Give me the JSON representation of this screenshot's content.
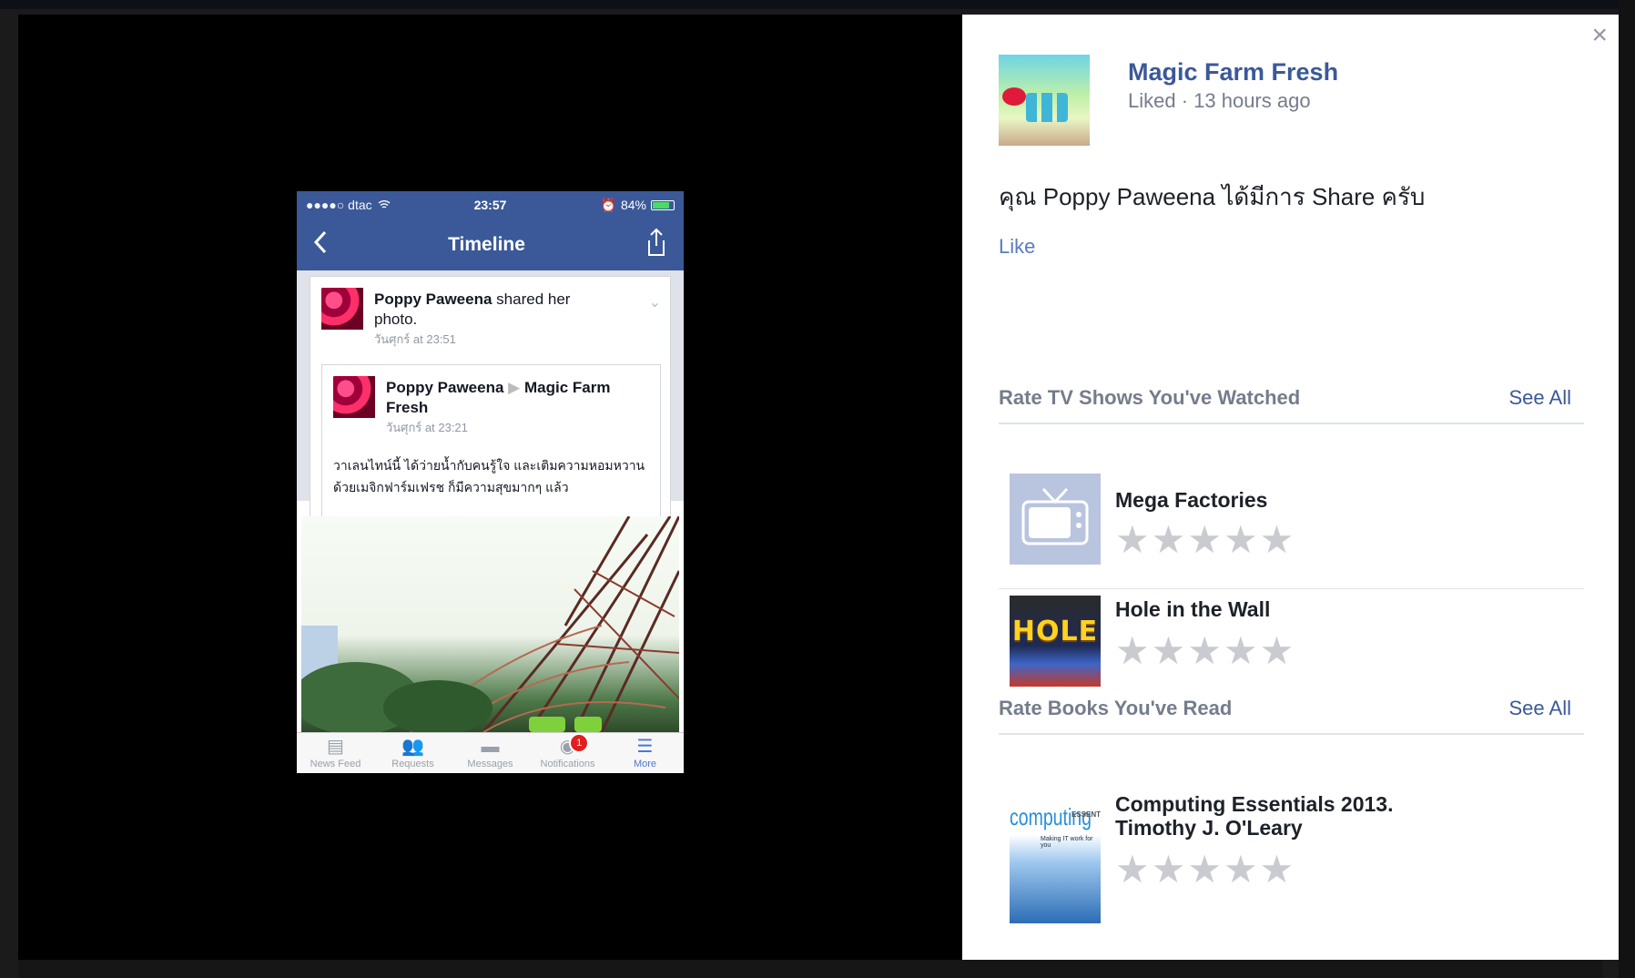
{
  "phone": {
    "status": {
      "carrier": "●●●●○ dtac",
      "time": "23:57",
      "battery": "84%"
    },
    "nav_title": "Timeline",
    "post": {
      "author": "Poppy Paweena",
      "action": "shared her photo.",
      "time": "วันศุกร์ at 23:51",
      "inner_author": "Poppy Paweena",
      "inner_arrow": "▶",
      "inner_target": "Magic Farm Fresh",
      "inner_time": "วันศุกร์ at 23:21",
      "text": "วาเลนไทน์นี้ ได้ว่ายน้ำกับคนรู้ใจ และเติมความหอมหวานด้วยเมจิกฟาร์มเฟรช ก็มีความสุขมากๆ แล้ว"
    },
    "tabs": [
      {
        "label": "News Feed",
        "icon": "news-feed-icon",
        "glyph": "▤"
      },
      {
        "label": "Requests",
        "icon": "friend-requests-icon",
        "glyph": "👥"
      },
      {
        "label": "Messages",
        "icon": "messages-icon",
        "glyph": "▬"
      },
      {
        "label": "Notifications",
        "icon": "globe-icon",
        "glyph": "◉",
        "badge": "1"
      },
      {
        "label": "More",
        "icon": "menu-icon",
        "glyph": "☰"
      }
    ]
  },
  "sidebar": {
    "close_label": "×",
    "page_name": "Magic Farm Fresh",
    "page_meta": "Liked · 13 hours ago",
    "post_text": "คุณ Poppy Paweena ได้มีการ Share ครับ",
    "like_label": "Like",
    "tv": {
      "title": "Rate TV Shows You've Watched",
      "see_all": "See All",
      "items": [
        {
          "name": "Mega Factories"
        },
        {
          "name": "Hole in the Wall",
          "thumb_text": "HOLE"
        }
      ]
    },
    "books": {
      "title": "Rate Books You've Read",
      "see_all": "See All",
      "items": [
        {
          "name": "Computing Essentials 2013. Timothy J. O'Leary",
          "thumb_text": "computing",
          "thumb_sub": "ESSENTIALS",
          "thumb_tag": "Making IT work for you"
        }
      ]
    },
    "star_glyph": "★"
  },
  "colors": {
    "facebook_blue": "#3b5998",
    "link_blue": "#5b7bbf",
    "muted": "#757c8b",
    "star_empty": "#c9cbd0"
  }
}
